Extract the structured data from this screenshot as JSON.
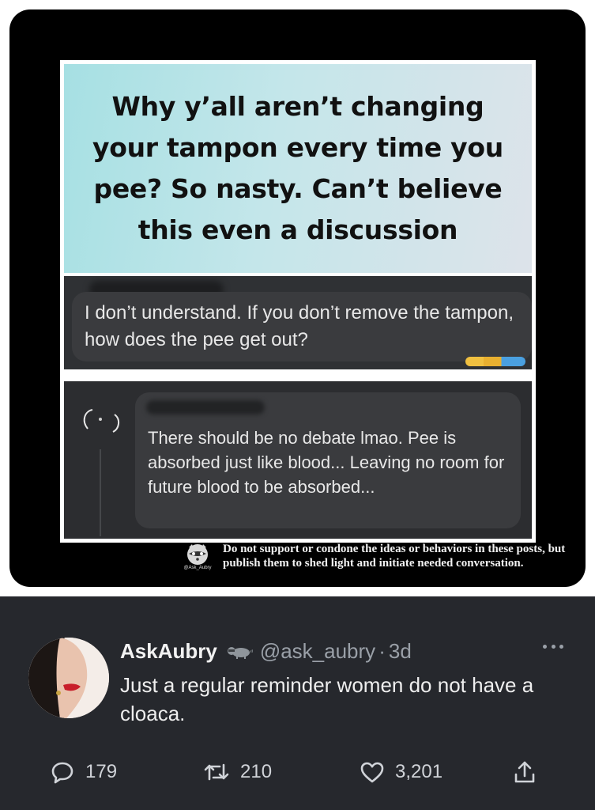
{
  "meme": {
    "headline": "Why y’all aren’t changing your tampon every time you pee? So nasty. Can’t believe this even a discussion",
    "comment_1": "I don’t understand. If you don’t remove the tampon, how does the pee get out?",
    "comment_2": "There should be no debate lmao. Pee is absorbed just like blood... Leaving no room for future blood to be absorbed...",
    "disclaimer_logo_handle": "@Ask_Aubry",
    "disclaimer": "Do not support or condone the ideas or behaviors in these posts, but publish them to shed light and initiate needed conversation.",
    "colors": {
      "headline_bg": "#b6e3e6",
      "comment_bg": "#2f3134"
    }
  },
  "tweet": {
    "display_name": "AskAubry",
    "badge_icon": "raccoon-icon",
    "handle": "@ask_aubry",
    "separator": "·",
    "time": "3d",
    "text": "Just a regular reminder women do not have a cloaca.",
    "actions": {
      "reply_count": "179",
      "retweet_count": "210",
      "like_count": "3,201"
    },
    "colors": {
      "background": "#26282d",
      "muted": "#9aa0a8",
      "text": "#eeeeee"
    }
  }
}
